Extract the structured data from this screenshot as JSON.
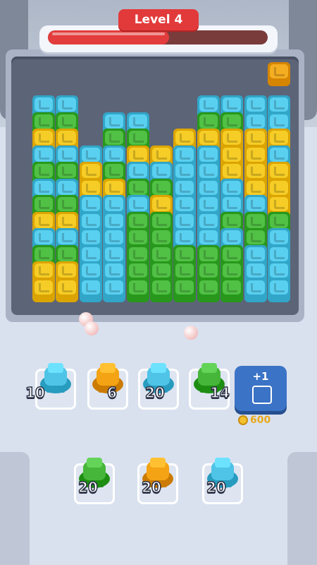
{
  "hud": {
    "level_label": "Level 4",
    "progress": 0.55,
    "progress_color": "#e33c3c"
  },
  "colors": {
    "blue": "#4fc4e6",
    "green": "#46b63a",
    "yellow": "#f9c21a",
    "orange": "#f3a314"
  },
  "board": {
    "columns": 11,
    "rows_note_hidden": true,
    "grid": [
      "..........O",
      "...........",
      "BB.....BBBB",
      "GG.BB..GGBB",
      "YY.GG.YYYYY",
      "BBBBYYBBYYB",
      "GGYGBBBBYYY",
      "BBYYGGBBBYY",
      "GGBBBYBBBBY",
      "YYBBGGBBGGG",
      "BBBBGGBBBGB",
      "GGBBGGGGGBB",
      "YYBBGGGGGBB",
      "YYBBGGGGGBB"
    ]
  },
  "shooters": [
    {
      "color": "blue",
      "count": "10",
      "icon": "cannon-icon"
    },
    {
      "color": "orange",
      "count": "6",
      "icon": "cannon-icon"
    },
    {
      "color": "blue",
      "count": "20",
      "icon": "cannon-icon"
    },
    {
      "color": "green",
      "count": "14",
      "icon": "cannon-icon"
    }
  ],
  "add_slot": {
    "label": "+1",
    "icon": "cannon-icon",
    "price": "600",
    "price_icon": "coin-icon"
  },
  "queue": [
    {
      "color": "green",
      "count": "20",
      "icon": "cannon-icon"
    },
    {
      "color": "orange",
      "count": "20",
      "icon": "cannon-icon"
    },
    {
      "color": "blue",
      "count": "20",
      "icon": "cannon-icon"
    }
  ]
}
